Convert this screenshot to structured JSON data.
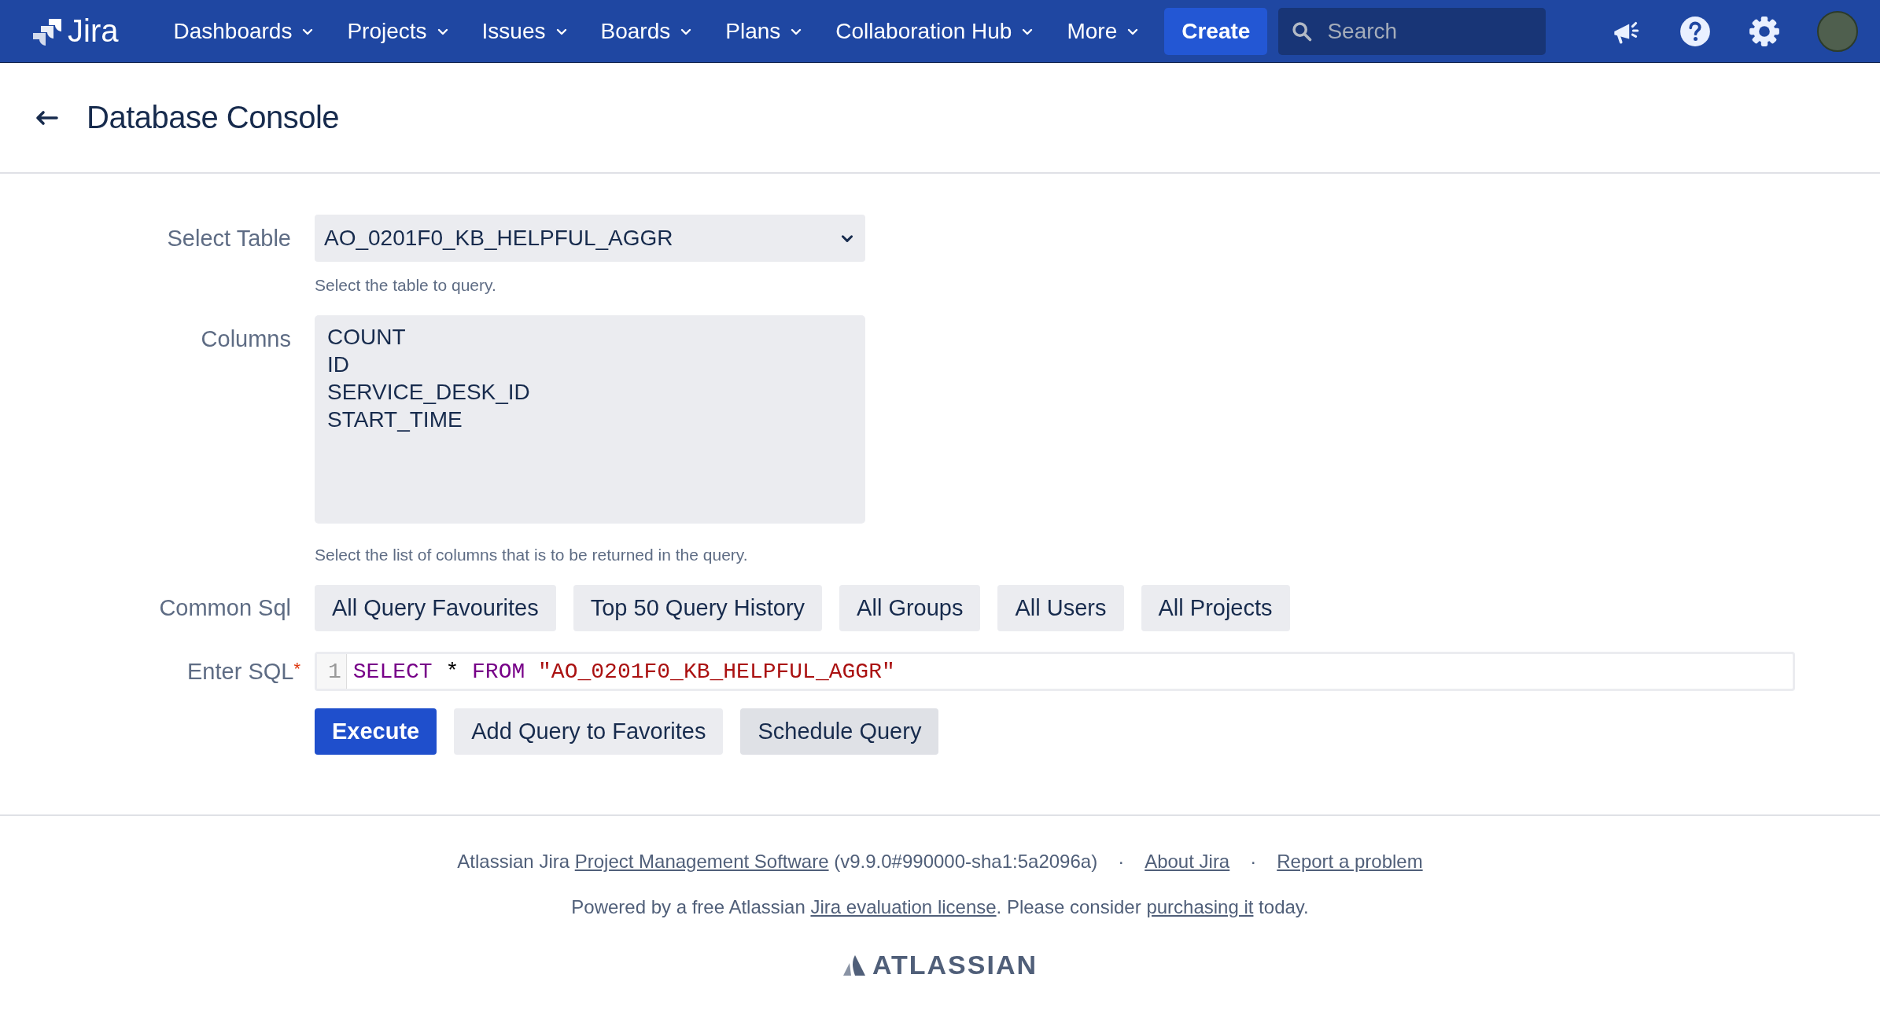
{
  "header": {
    "logo": "Jira",
    "nav": [
      {
        "label": "Dashboards"
      },
      {
        "label": "Projects"
      },
      {
        "label": "Issues"
      },
      {
        "label": "Boards"
      },
      {
        "label": "Plans"
      },
      {
        "label": "Collaboration Hub"
      },
      {
        "label": "More"
      }
    ],
    "create_button": "Create",
    "search": {
      "placeholder": "Search"
    }
  },
  "page": {
    "title": "Database Console"
  },
  "form": {
    "select_table": {
      "label": "Select Table",
      "value": "AO_0201F0_KB_HELPFUL_AGGR",
      "hint": "Select the table to query."
    },
    "columns": {
      "label": "Columns",
      "options": [
        "COUNT",
        "ID",
        "SERVICE_DESK_ID",
        "START_TIME"
      ],
      "hint": "Select the list of columns that is to be returned in the query."
    },
    "common_sql": {
      "label": "Common Sql",
      "buttons": [
        "All Query Favourites",
        "Top 50 Query History",
        "All Groups",
        "All Users",
        "All Projects"
      ]
    },
    "sql": {
      "label": "Enter SQL",
      "required_mark": "*",
      "line_number": "1",
      "tokens": [
        {
          "kind": "keyword",
          "text": "SELECT"
        },
        {
          "kind": "operator",
          "text": "*"
        },
        {
          "kind": "keyword",
          "text": "FROM"
        },
        {
          "kind": "string",
          "text": "\"AO_0201F0_KB_HELPFUL_AGGR\""
        }
      ]
    },
    "actions": [
      {
        "label": "Execute",
        "kind": "primary"
      },
      {
        "label": "Add Query to Favorites",
        "kind": "default"
      },
      {
        "label": "Schedule Query",
        "kind": "hover"
      }
    ]
  },
  "footer": {
    "line1": [
      {
        "kind": "sentence",
        "parts": [
          {
            "kind": "text",
            "text": "Atlassian Jira "
          },
          {
            "kind": "link",
            "text": "Project Management Software"
          },
          {
            "kind": "text",
            "text": " (v9.9.0#990000-sha1:5a2096a)"
          }
        ]
      },
      {
        "kind": "separator",
        "text": "·"
      },
      {
        "kind": "link",
        "text": "About Jira"
      },
      {
        "kind": "separator",
        "text": "·"
      },
      {
        "kind": "link",
        "text": "Report a problem"
      }
    ],
    "line2": [
      {
        "kind": "text",
        "text": "Powered by a free Atlassian "
      },
      {
        "kind": "link",
        "text": "Jira evaluation license"
      },
      {
        "kind": "text",
        "text": ". Please consider "
      },
      {
        "kind": "link",
        "text": "purchasing it"
      },
      {
        "kind": "text",
        "text": " today."
      }
    ],
    "brand": "ATLASSIAN"
  }
}
